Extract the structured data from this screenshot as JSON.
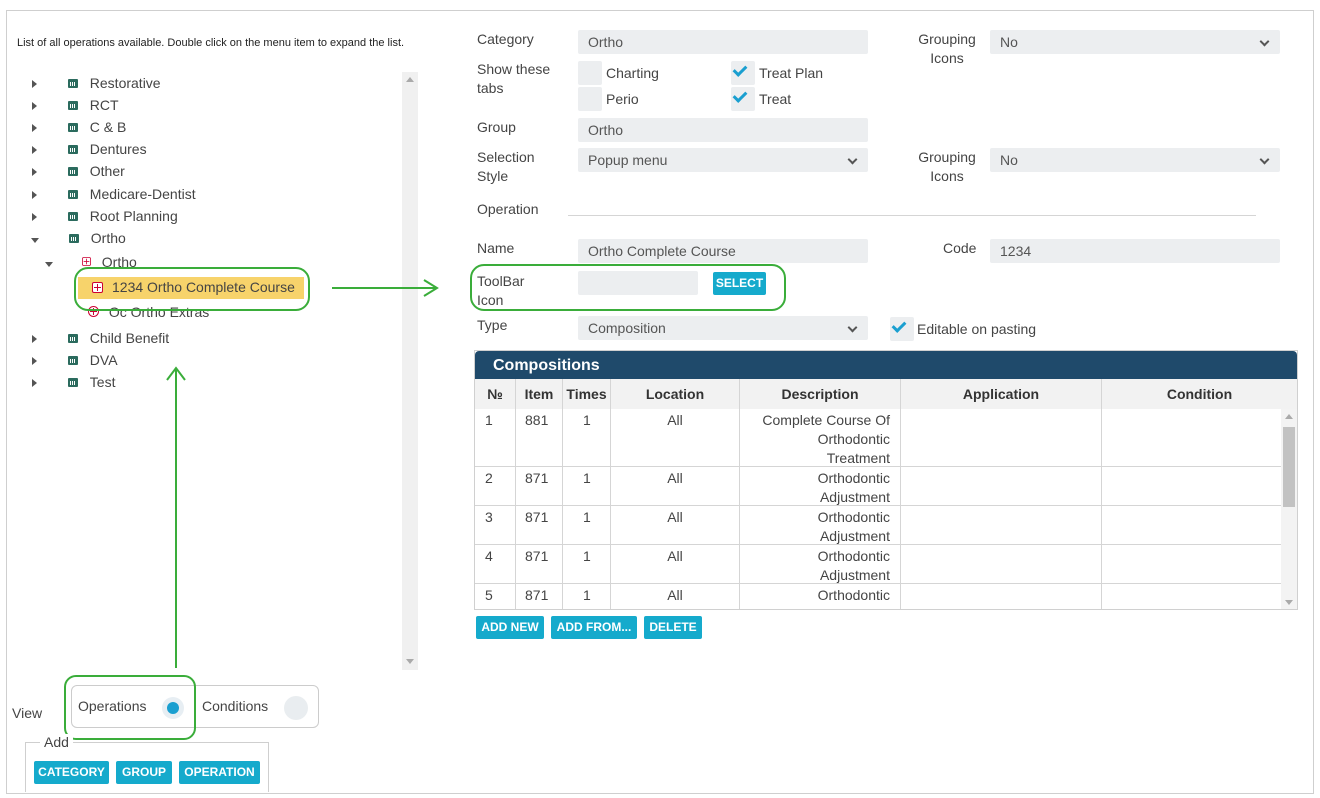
{
  "tree": {
    "hint": "List of all operations available. Double click on the menu item to expand the list.",
    "categories": [
      {
        "label": "Restorative"
      },
      {
        "label": "RCT"
      },
      {
        "label": "C & B"
      },
      {
        "label": "Dentures"
      },
      {
        "label": "Other"
      },
      {
        "label": "Medicare-Dentist"
      },
      {
        "label": "Root Planning"
      },
      {
        "label": "Ortho"
      }
    ],
    "group": "Ortho",
    "selected_item": "1234 Ortho Complete Course",
    "next_item": "Oc Ortho Extras",
    "categories_after": [
      {
        "label": "Child Benefit"
      },
      {
        "label": "DVA"
      },
      {
        "label": "Test"
      }
    ]
  },
  "view": {
    "label": "View",
    "operations": "Operations",
    "conditions": "Conditions",
    "selected": "Operations"
  },
  "add": {
    "legend": "Add",
    "category_btn": "CATEGORY",
    "group_btn": "GROUP",
    "operation_btn": "OPERATION"
  },
  "form": {
    "category_label": "Category",
    "category_value": "Ortho",
    "grouping_icons_label_1": "Grouping Icons",
    "grouping_icons_value_1": "No",
    "show_tabs_label": "Show these tabs",
    "tabs": {
      "charting": {
        "label": "Charting",
        "checked": false
      },
      "treat_plan": {
        "label": "Treat Plan",
        "checked": true
      },
      "perio": {
        "label": "Perio",
        "checked": false
      },
      "treat": {
        "label": "Treat",
        "checked": true
      }
    },
    "group_label": "Group",
    "group_value": "Ortho",
    "selection_style_label": "Selection Style",
    "selection_style_value": "Popup menu",
    "grouping_icons_label_2": "Grouping Icons",
    "grouping_icons_value_2": "No",
    "operation_label": "Operation",
    "name_label": "Name",
    "name_value": "Ortho Complete Course",
    "code_label": "Code",
    "code_value": "1234",
    "toolbar_icon_label": "ToolBar Icon",
    "select_btn": "SELECT",
    "type_label": "Type",
    "type_value": "Composition",
    "editable_label": "Editable on pasting",
    "editable_checked": true
  },
  "compositions": {
    "title": "Compositions",
    "headers": [
      "№",
      "Item",
      "Times",
      "Location",
      "Description",
      "Application",
      "Condition"
    ],
    "rows": [
      {
        "no": "1",
        "item": "881",
        "times": "1",
        "location": "All",
        "desc1": "Complete Course Of",
        "desc2": "Orthodontic",
        "desc3": "Treatment"
      },
      {
        "no": "2",
        "item": "871",
        "times": "1",
        "location": "All",
        "desc1": "Orthodontic",
        "desc2": "Adjustment",
        "desc3": ""
      },
      {
        "no": "3",
        "item": "871",
        "times": "1",
        "location": "All",
        "desc1": "Orthodontic",
        "desc2": "Adjustment",
        "desc3": ""
      },
      {
        "no": "4",
        "item": "871",
        "times": "1",
        "location": "All",
        "desc1": "Orthodontic",
        "desc2": "Adjustment",
        "desc3": ""
      },
      {
        "no": "5",
        "item": "871",
        "times": "1",
        "location": "All",
        "desc1": "Orthodontic",
        "desc2": "",
        "desc3": ""
      }
    ],
    "add_new_btn": "ADD NEW",
    "add_from_btn": "ADD FROM...",
    "delete_btn": "DELETE"
  },
  "colors": {
    "accent": "#15aacc",
    "header_bg": "#1f4a6b",
    "highlight": "#f7d36b",
    "annotation": "#3aad3a"
  }
}
